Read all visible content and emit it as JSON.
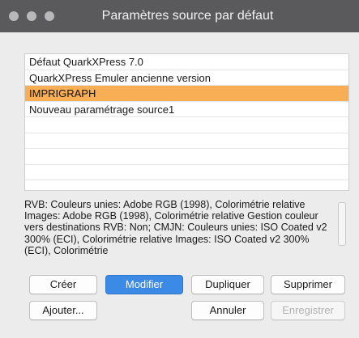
{
  "window": {
    "title": "Paramètres source par défaut"
  },
  "source_list": {
    "items": [
      {
        "label": "Défaut QuarkXPress 7.0",
        "selected": false
      },
      {
        "label": "QuarkXPress Emuler ancienne version",
        "selected": false
      },
      {
        "label": "IMPRIGRAPH",
        "selected": true
      },
      {
        "label": "Nouveau paramétrage source1",
        "selected": false
      }
    ]
  },
  "description": "RVB: Couleurs unies: Adobe RGB (1998), Colorimétrie relative Images: Adobe RGB (1998), Colorimétrie relative Gestion couleur vers destinations RVB: Non; CMJN: Couleurs unies: ISO Coated v2 300% (ECI), Colorimétrie relative Images: ISO Coated v2 300% (ECI), Colorimétrie",
  "buttons": {
    "create": "Créer",
    "modify": "Modifier",
    "duplicate": "Dupliquer",
    "delete": "Supprimer",
    "add": "Ajouter...",
    "cancel": "Annuler",
    "save": "Enregistrer"
  },
  "colors": {
    "selection": "#f7ae55",
    "primary_button": "#3a8ae6",
    "titlebar": "#5a5a5c"
  }
}
